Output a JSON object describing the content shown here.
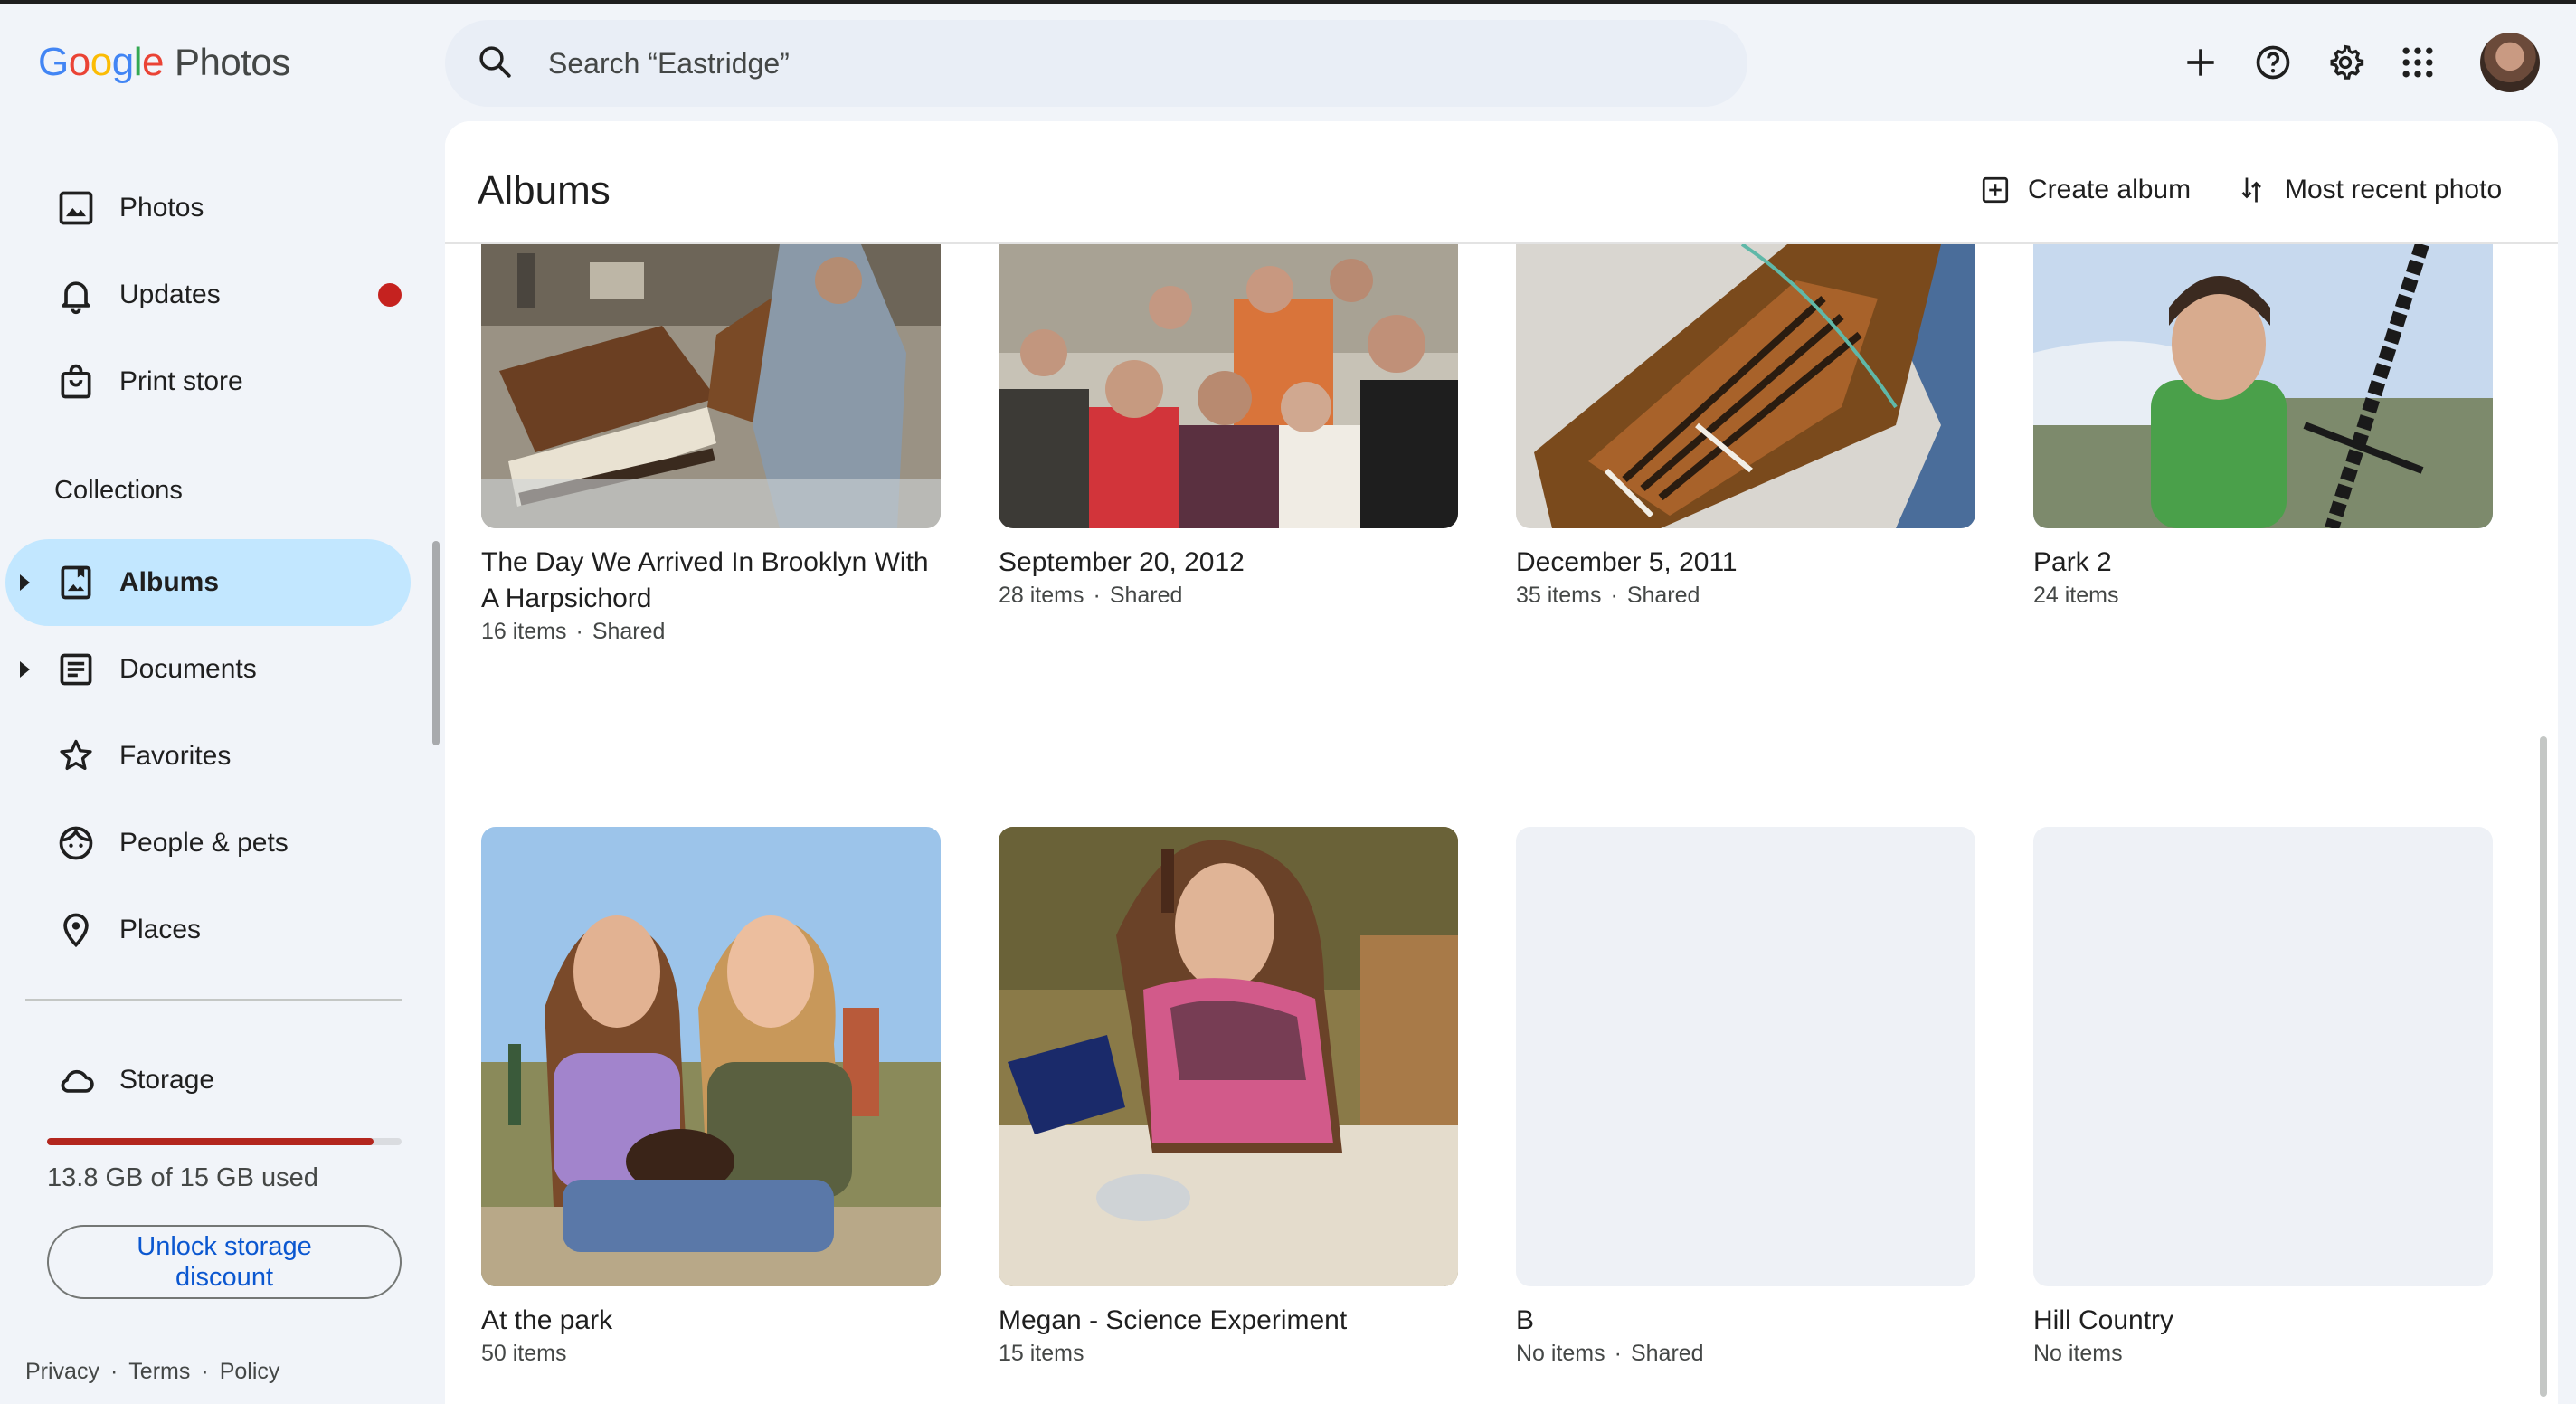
{
  "app": {
    "logo_letters": [
      "G",
      "o",
      "o",
      "g",
      "l",
      "e"
    ],
    "product": "Photos"
  },
  "search": {
    "placeholder": "Search “Eastridge”"
  },
  "top_icons": [
    "plus-icon",
    "help-icon",
    "settings-icon",
    "apps-grid-icon",
    "account-avatar"
  ],
  "sidebar": {
    "items": [
      {
        "label": "Photos",
        "icon": "photo-icon"
      },
      {
        "label": "Updates",
        "icon": "bell-icon",
        "badge": true
      },
      {
        "label": "Print store",
        "icon": "shopping-bag-icon"
      }
    ],
    "collections_label": "Collections",
    "collections": [
      {
        "label": "Albums",
        "icon": "album-icon",
        "active": true,
        "expandable": true
      },
      {
        "label": "Documents",
        "icon": "document-icon",
        "expandable": true
      },
      {
        "label": "Favorites",
        "icon": "star-icon"
      },
      {
        "label": "People & pets",
        "icon": "face-icon"
      },
      {
        "label": "Places",
        "icon": "pin-icon"
      }
    ],
    "storage": {
      "label": "Storage",
      "usage_text": "13.8 GB of 15 GB used",
      "used_fraction": 0.92,
      "cta": "Unlock storage discount"
    },
    "footer": [
      "Privacy",
      "·",
      "Terms",
      "·",
      "Policy"
    ]
  },
  "main": {
    "title": "Albums",
    "create_album": "Create album",
    "sort": "Most recent photo",
    "albums": [
      {
        "title": "The Day We Arrived In Brooklyn With A Harpsichord",
        "count": "16 items",
        "shared": "Shared",
        "thumb": "harpsichord"
      },
      {
        "title": "September 20, 2012",
        "count": "28 items",
        "shared": "Shared",
        "thumb": "group"
      },
      {
        "title": "December 5, 2011",
        "count": "35 items",
        "shared": "Shared",
        "thumb": "instrument"
      },
      {
        "title": "Park 2",
        "count": "24 items",
        "shared": "",
        "thumb": "swing"
      },
      {
        "title": "At the park",
        "count": "50 items",
        "shared": "",
        "thumb": "girls"
      },
      {
        "title": "Megan - Science Experiment",
        "count": "15 items",
        "shared": "",
        "thumb": "kitchen"
      },
      {
        "title": "B",
        "count": "No items",
        "shared": "Shared",
        "thumb": "empty"
      },
      {
        "title": "Hill Country",
        "count": "No items",
        "shared": "",
        "thumb": "empty"
      }
    ]
  }
}
